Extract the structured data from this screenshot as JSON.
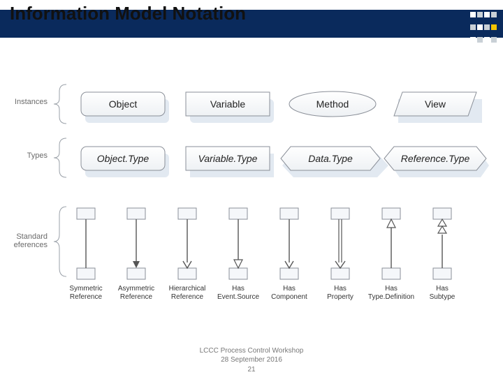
{
  "title": "Information Model Notation",
  "row_labels": {
    "instances": "Instances",
    "types": "Types",
    "references": "Standard\nReferences"
  },
  "instances": {
    "object": "Object",
    "variable": "Variable",
    "method": "Method",
    "view": "View"
  },
  "types": {
    "object_type": "Object.Type",
    "variable_type": "Variable.Type",
    "data_type": "Data.Type",
    "reference_type": "Reference.Type"
  },
  "references": {
    "symmetric": "Symmetric\nReference",
    "asymmetric": "Asymmetric\nReference",
    "hierarchical": "Hierarchical\nReference",
    "has_eventsource": "Has\nEvent.Source",
    "has_component": "Has\nComponent",
    "has_property": "Has\nProperty",
    "has_typedef": "Has\nType.Definition",
    "has_subtype": "Has\nSubtype"
  },
  "footer": {
    "line1": "LCCC Process Control Workshop",
    "line2": "28 September 2016",
    "page": "21"
  }
}
